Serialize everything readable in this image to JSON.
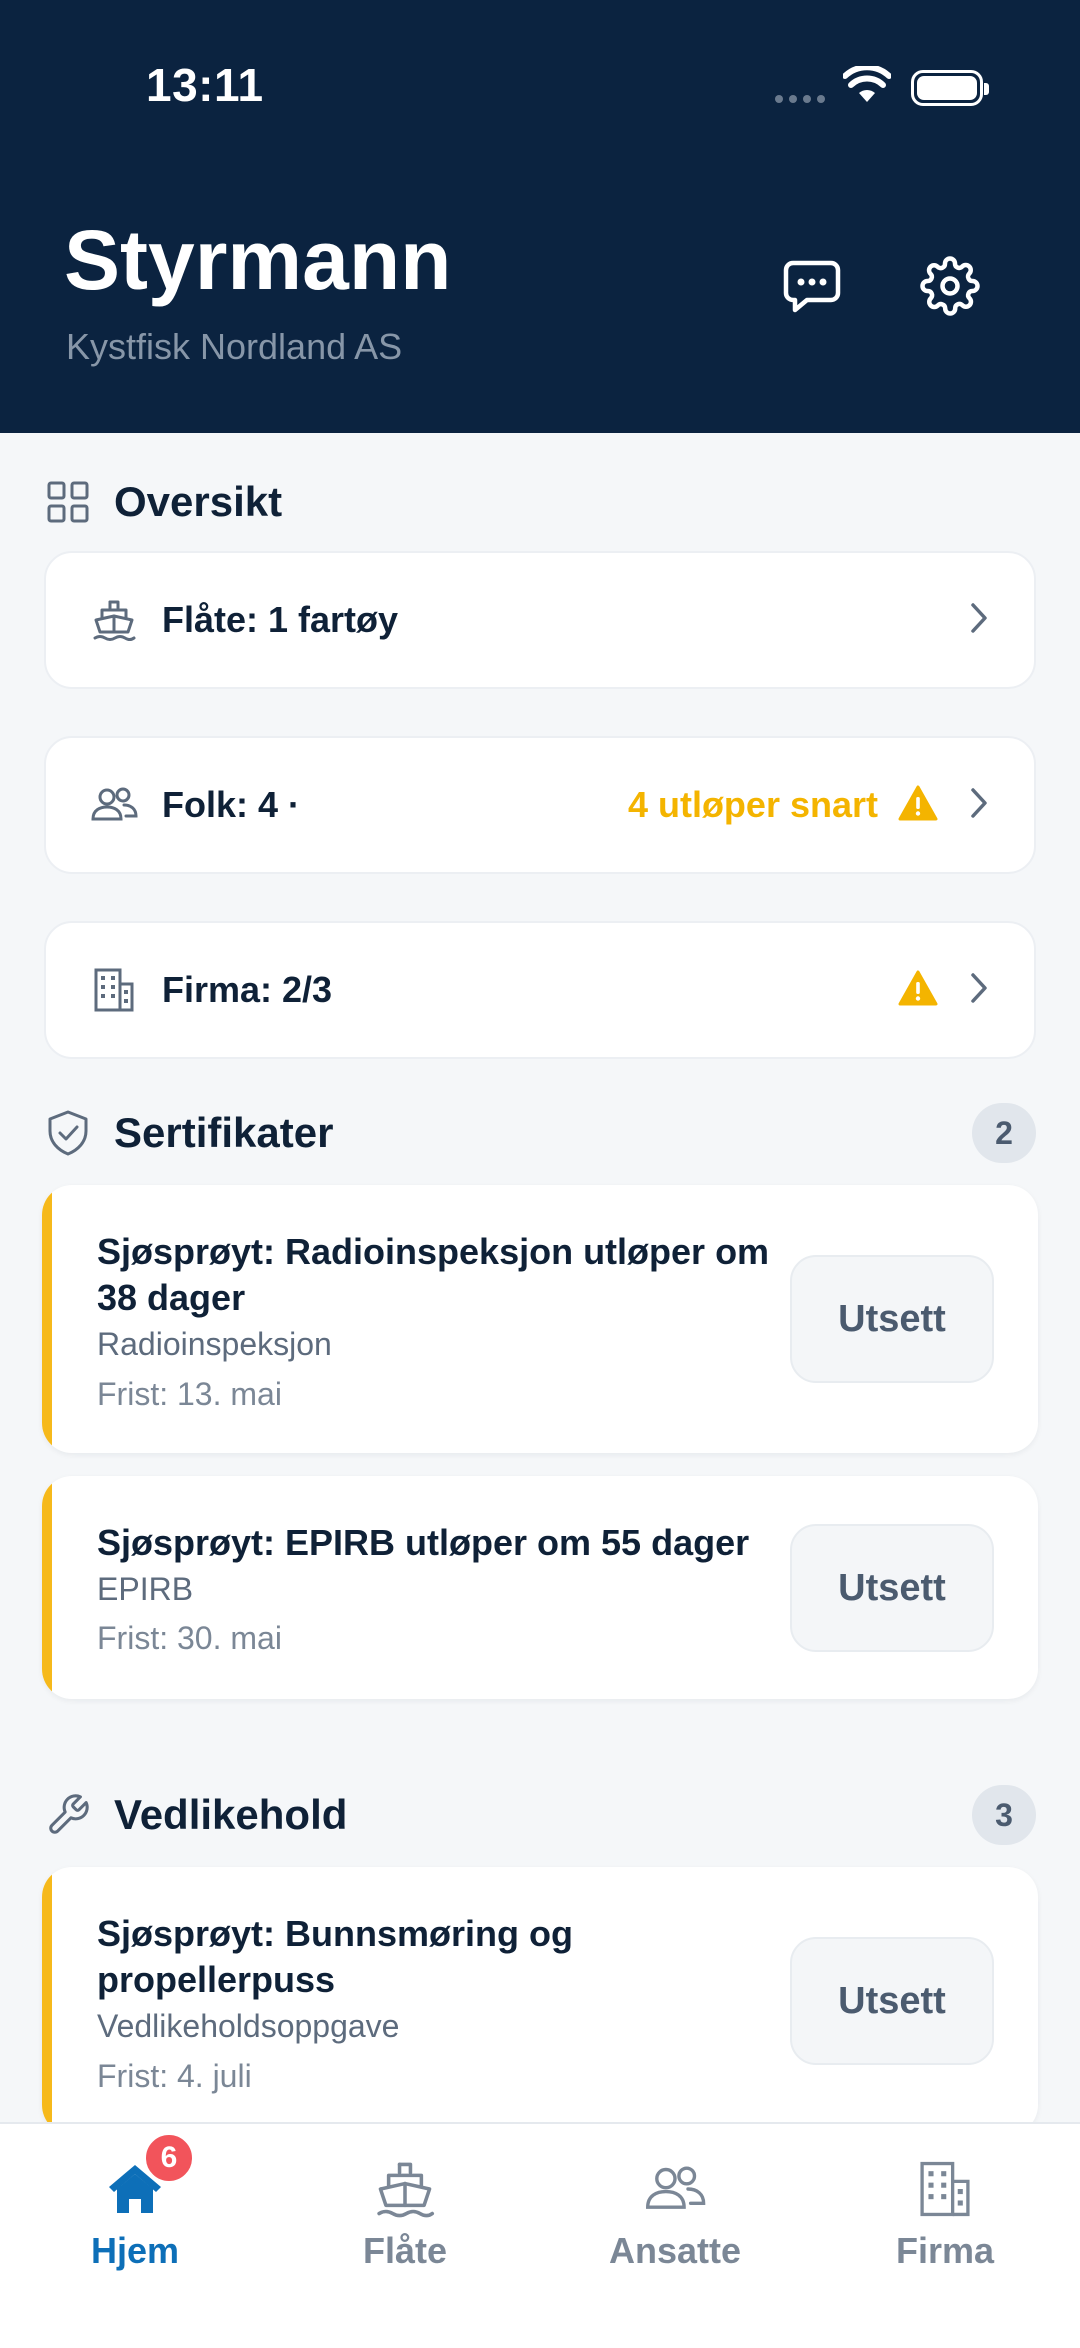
{
  "status_bar": {
    "time": "13:11"
  },
  "header": {
    "title": "Styrmann",
    "subtitle": "Kystfisk Nordland AS"
  },
  "overview": {
    "title": "Oversikt",
    "cards": [
      {
        "label": "Flåte: 1 fartøy",
        "warning_text": "",
        "icon": "ship-icon"
      },
      {
        "label": "Folk: 4 ·",
        "warning_text": "4 utløper snart",
        "icon": "people-icon"
      },
      {
        "label": "Firma: 2/3",
        "warning_text": "",
        "icon": "building-icon"
      }
    ]
  },
  "certificates": {
    "title": "Sertifikater",
    "count": "2",
    "items": [
      {
        "title": "Sjøsprøyt: Radioinspeksjon utløper om 38 dager",
        "subtitle": "Radioinspeksjon",
        "due": "Frist: 13. mai",
        "action": "Utsett"
      },
      {
        "title": "Sjøsprøyt: EPIRB utløper om 55 dager",
        "subtitle": "EPIRB",
        "due": "Frist: 30. mai",
        "action": "Utsett"
      }
    ]
  },
  "maintenance": {
    "title": "Vedlikehold",
    "count": "3",
    "items": [
      {
        "title": "Sjøsprøyt: Bunnsmøring og propellerpuss",
        "subtitle": "Vedlikeholdsoppgave",
        "due": "Frist: 4. juli",
        "action": "Utsett"
      }
    ]
  },
  "tabbar": {
    "tabs": [
      {
        "label": "Hjem",
        "badge": "6",
        "active": true
      },
      {
        "label": "Flåte"
      },
      {
        "label": "Ansatte"
      },
      {
        "label": "Firma"
      }
    ]
  },
  "colors": {
    "header_bg": "#0b2340",
    "accent_warning": "#f4b400",
    "active_tab": "#0d6fb8",
    "badge_red": "#f2545b"
  }
}
